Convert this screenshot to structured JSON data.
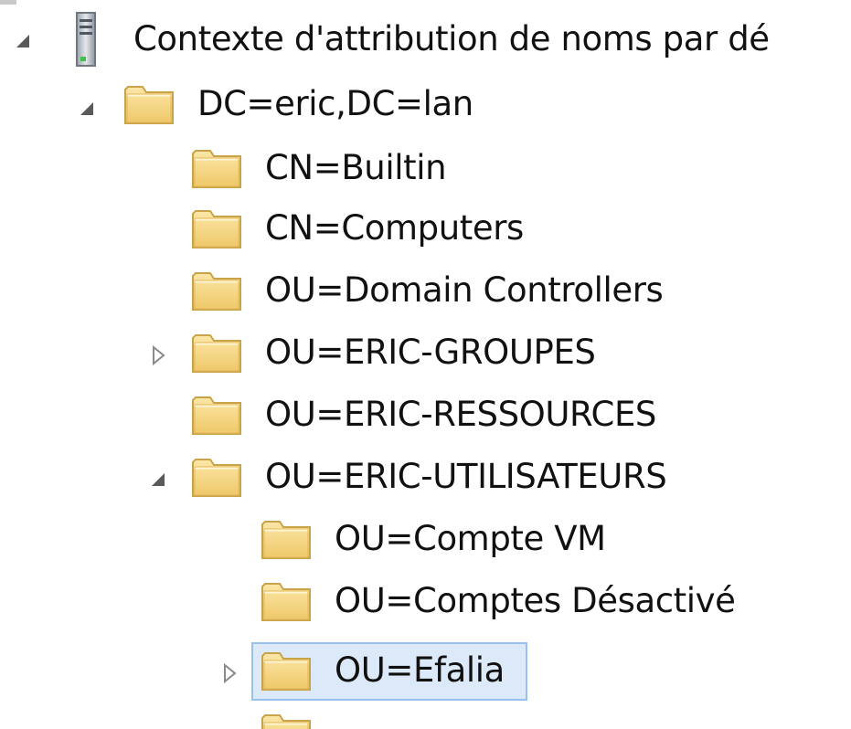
{
  "tree": {
    "root": {
      "label": "Contexte d'attribution de noms par dé",
      "icon": "server-icon",
      "expanded": true
    },
    "domain": {
      "label": "DC=eric,DC=lan",
      "icon": "folder-icon",
      "expanded": true
    },
    "items": [
      {
        "label": "CN=Builtin",
        "has_children": false
      },
      {
        "label": "CN=Computers",
        "has_children": false
      },
      {
        "label": "OU=Domain Controllers",
        "has_children": false
      },
      {
        "label": "OU=ERIC-GROUPES",
        "has_children": true,
        "expanded": false
      },
      {
        "label": "OU=ERIC-RESSOURCES",
        "has_children": false
      },
      {
        "label": "OU=ERIC-UTILISATEURS",
        "has_children": true,
        "expanded": true
      }
    ],
    "sub_items": [
      {
        "label": "OU=Compte VM",
        "has_children": false
      },
      {
        "label": "OU=Comptes Désactivé",
        "has_children": false
      },
      {
        "label": "OU=Efalia",
        "has_children": true,
        "expanded": false,
        "selected": true
      }
    ]
  },
  "colors": {
    "selection_fill": "#dbe9f8",
    "selection_border": "#98c2ec",
    "folder_fill": "#f4d27a",
    "folder_edge": "#c9a34a"
  }
}
